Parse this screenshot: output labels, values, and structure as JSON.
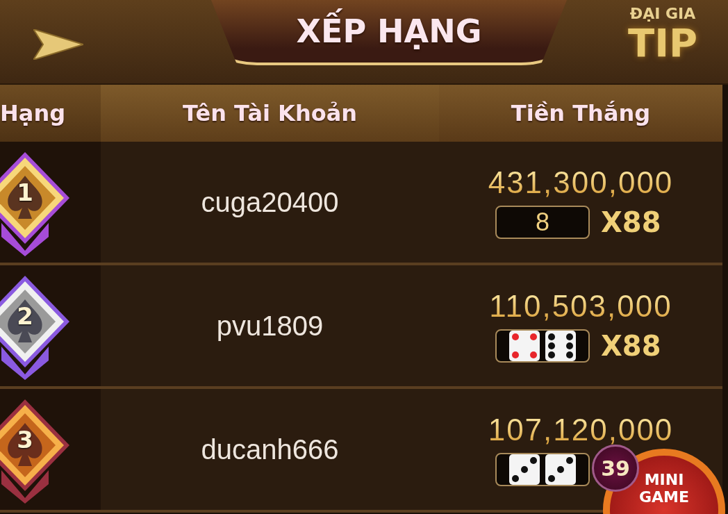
{
  "header": {
    "title": "XẾP HẠNG",
    "tip_tab": {
      "top": "ĐẠI GIA",
      "bottom": "TIP"
    }
  },
  "table": {
    "columns": [
      "Hạng",
      "Tên Tài Khoản",
      "Tiền Thắng"
    ],
    "rows": [
      {
        "rank": "1",
        "kind": "gold",
        "user": "cuga20400",
        "amount": "431,300,000",
        "result": {
          "kind": "number",
          "text": "8"
        },
        "multiplier": "X88"
      },
      {
        "rank": "2",
        "kind": "silver",
        "user": "pvu1809",
        "amount": "110,503,000",
        "result": {
          "kind": "dice",
          "dice": [
            {
              "kind": "four"
            },
            {
              "kind": "six"
            }
          ]
        },
        "multiplier": "X88"
      },
      {
        "rank": "3",
        "kind": "bronze",
        "user": "ducanh666",
        "amount": "107,120,000",
        "result": {
          "kind": "dice",
          "dice": [
            {
              "kind": "three"
            },
            {
              "kind": "three"
            }
          ]
        }
      }
    ]
  },
  "mini_game": {
    "label": "MINI GAME",
    "count": "39"
  }
}
